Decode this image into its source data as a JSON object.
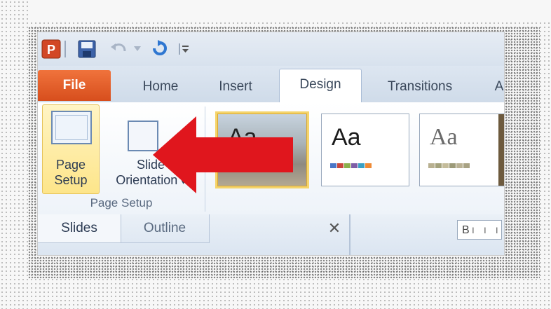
{
  "quick_access": {
    "app_icon": "powerpoint-app-icon",
    "items": [
      "save-icon",
      "undo-icon",
      "redo-icon",
      "customize-icon"
    ]
  },
  "tabs": {
    "file": "File",
    "home": "Home",
    "insert": "Insert",
    "design": "Design",
    "transitions": "Transitions",
    "cut": "A"
  },
  "page_setup_group": {
    "page_setup_line1": "Page",
    "page_setup_line2": "Setup",
    "orientation_line1": "Slide",
    "orientation_line2": "Orientation",
    "orientation_caret": "▾",
    "group_label": "Page Setup"
  },
  "themes": {
    "items": [
      {
        "sample": "Aa",
        "selected": true
      },
      {
        "sample": "Aa",
        "selected": false
      },
      {
        "sample": "Aa",
        "selected": false
      }
    ]
  },
  "pane": {
    "slides_tab": "Slides",
    "outline_tab": "Outline",
    "close_glyph": "✕",
    "status_text": "B"
  },
  "colors": {
    "file_tab": "#e25c28",
    "highlight": "#fde58a",
    "arrow": "#e0161d"
  }
}
